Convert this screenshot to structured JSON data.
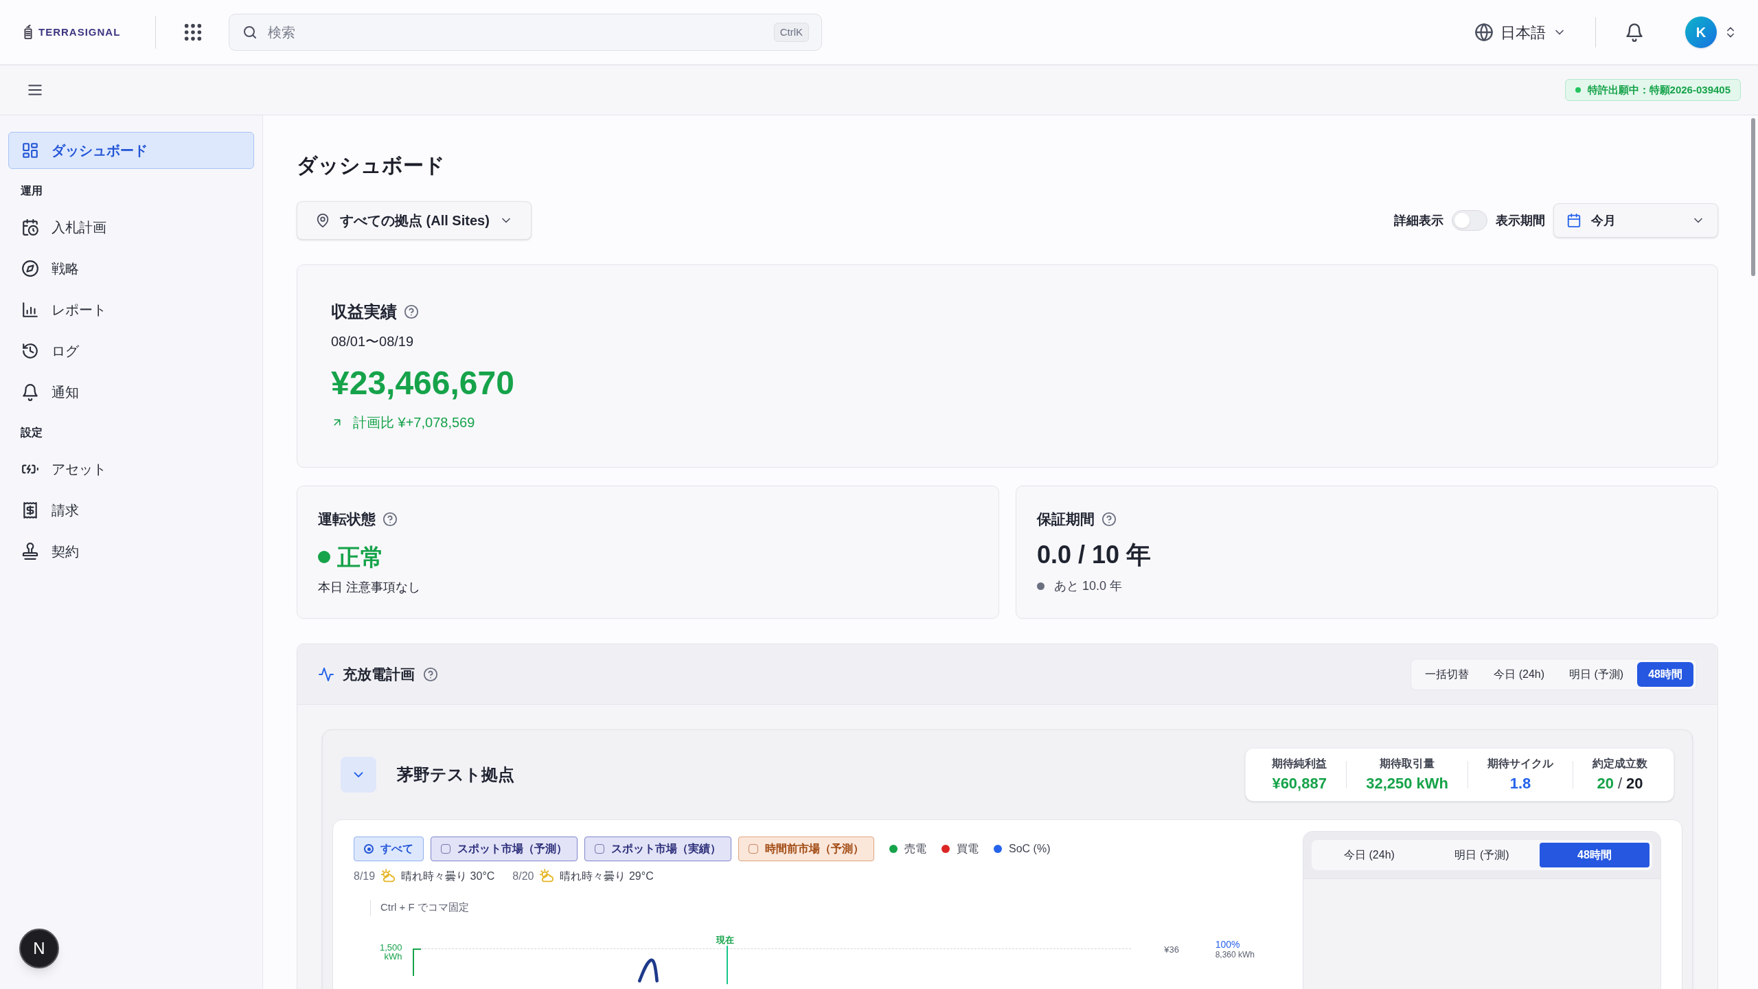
{
  "header": {
    "logo": "TERRASIGNAL",
    "search": {
      "placeholder": "検索",
      "shortcut": "CtrlK"
    },
    "language": "日本語",
    "avatar": "K"
  },
  "subbar": {
    "patent_badge": "特許出願中：特願2026-039405"
  },
  "sidebar": {
    "groups": [
      {
        "items": [
          {
            "label": "ダッシュボード",
            "selected": true
          }
        ]
      },
      {
        "heading": "運用",
        "items": [
          {
            "label": "入札計画",
            "selected": false
          },
          {
            "label": "戦略",
            "selected": false
          },
          {
            "label": "レポート",
            "selected": false
          },
          {
            "label": "ログ",
            "selected": false
          },
          {
            "label": "通知",
            "selected": false
          }
        ]
      },
      {
        "heading": "設定",
        "items": [
          {
            "label": "アセット",
            "selected": false
          },
          {
            "label": "請求",
            "selected": false
          },
          {
            "label": "契約",
            "selected": false
          }
        ]
      }
    ]
  },
  "floating_button": "N",
  "page": {
    "title": "ダッシュボード",
    "site_selector": "すべての拠点 (All Sites)",
    "detail_toggle": {
      "label": "詳細表示",
      "on": false
    },
    "period": {
      "label": "表示期間",
      "value": "今月"
    }
  },
  "revenue": {
    "title": "収益実績",
    "date_range": "08/01〜08/19",
    "amount": "¥23,466,670",
    "vs_plan": "計画比 ¥+7,078,569"
  },
  "status": {
    "title": "運転状態",
    "value": "正常",
    "note": "本日 注意事項なし"
  },
  "warranty": {
    "title": "保証期間",
    "value": "0.0 / 10 年",
    "remaining": "あと 10.0 年"
  },
  "plan": {
    "title": "充放電計画",
    "range_tabs": [
      {
        "label": "一括切替",
        "selected": false
      },
      {
        "label": "今日 (24h)",
        "selected": false
      },
      {
        "label": "明日 (予測)",
        "selected": false
      },
      {
        "label": "48時間",
        "selected": true
      }
    ],
    "site": {
      "name": "茅野テスト拠点",
      "expanded": true,
      "stats": [
        {
          "label": "期待純利益",
          "value": "¥60,887",
          "color": "#16a34a"
        },
        {
          "label": "期待取引量",
          "value": "32,250 kWh",
          "color": "#16a34a"
        },
        {
          "label": "期待サイクル",
          "value": "1.8",
          "color": "#2563eb"
        },
        {
          "label": "約定成立数",
          "value": "20",
          "separator": "/",
          "total": "20",
          "color": "#16a34a"
        }
      ],
      "filters": [
        {
          "label": "すべて",
          "kind": "all",
          "selected": true
        },
        {
          "label": "スポット市場（予測）",
          "kind": "spot",
          "selected": false
        },
        {
          "label": "スポット市場（実績）",
          "kind": "spot",
          "selected": false
        },
        {
          "label": "時間前市場（予測）",
          "kind": "intraday",
          "selected": false
        }
      ],
      "legend": [
        {
          "label": "売電",
          "color": "#16a34a"
        },
        {
          "label": "買電",
          "color": "#dc2626"
        },
        {
          "label": "SoC (%)",
          "color": "#2563eb"
        }
      ],
      "weather": [
        {
          "date": "8/19",
          "text": "晴れ時々曇り 30°C"
        },
        {
          "date": "8/20",
          "text": "晴れ時々曇り 29°C"
        }
      ],
      "hint": "Ctrl + F でコマ固定",
      "chart_labels": {
        "left_value": "1,500",
        "left_unit": "kWh",
        "now": "現在",
        "price": "¥36",
        "soc": "100%",
        "soc_kwh": "8,360 kWh"
      },
      "panel_tabs": [
        {
          "label": "今日 (24h)",
          "selected": false
        },
        {
          "label": "明日 (予測)",
          "selected": false
        },
        {
          "label": "48時間",
          "selected": true
        }
      ]
    }
  }
}
